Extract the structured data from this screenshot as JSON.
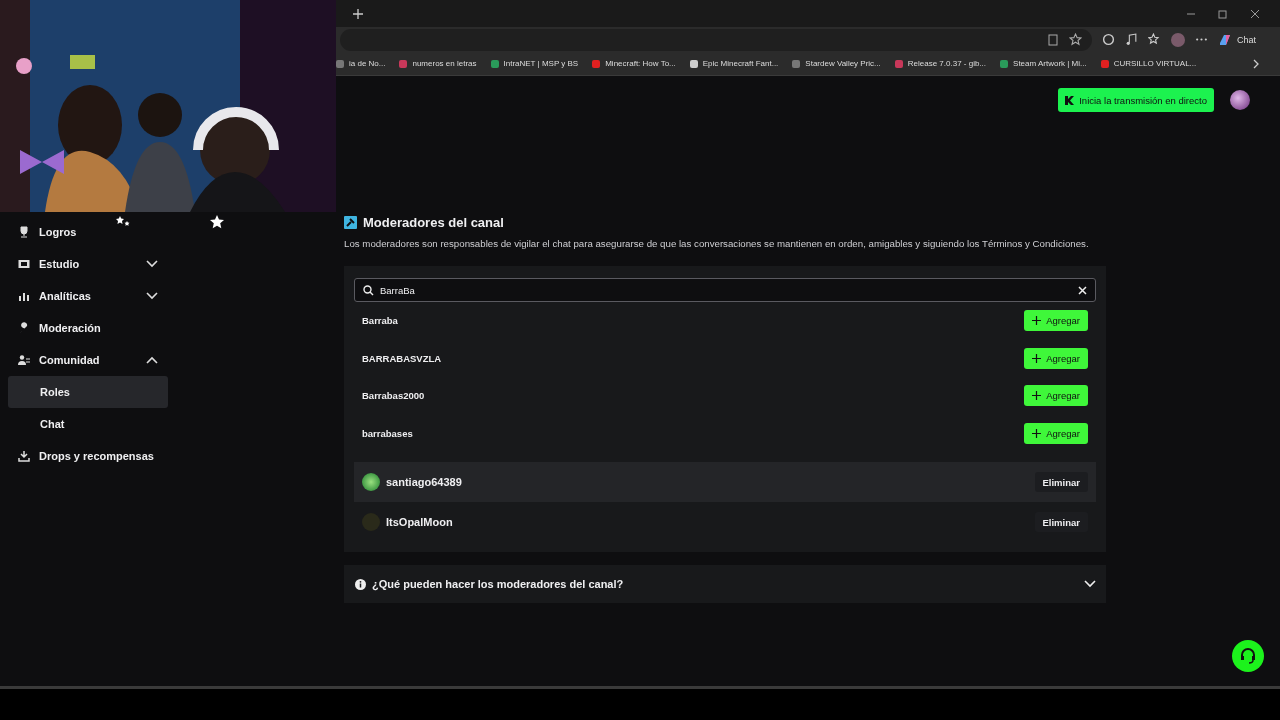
{
  "browser": {
    "chat_label": "Chat",
    "bookmarks": [
      "ia de No...",
      "numeros en letras",
      "IntraNET | MSP y BS",
      "Minecraft: How To...",
      "Epic Minecraft Fant...",
      "Stardew Valley Pric...",
      "Release 7.0.37 - gib...",
      "Steam Artwork | Mi...",
      "CURSILLO VIRTUAL..."
    ]
  },
  "header": {
    "go_live_button": "Inicia la transmisión en directo"
  },
  "sidebar": {
    "items": [
      {
        "label": "Logros"
      },
      {
        "label": "Estudio",
        "expanded": false
      },
      {
        "label": "Analíticas",
        "expanded": false
      },
      {
        "label": "Moderación"
      },
      {
        "label": "Comunidad",
        "expanded": true,
        "children": [
          {
            "label": "Roles",
            "selected": true
          },
          {
            "label": "Chat",
            "selected": false
          }
        ]
      },
      {
        "label": "Drops y recompensas"
      }
    ]
  },
  "moderators": {
    "title": "Moderadores del canal",
    "description": "Los moderadores son responsables de vigilar el chat para asegurarse de que las conversaciones se mantienen en orden, amigables y siguiendo los Términos y Condiciones.",
    "search": {
      "value": "BarraBa"
    },
    "results": [
      {
        "name": "Barraba",
        "button": "Agregar"
      },
      {
        "name": "BARRABASVZLA",
        "button": "Agregar"
      },
      {
        "name": "Barrabas2000",
        "button": "Agregar"
      },
      {
        "name": "barrabases",
        "button": "Agregar"
      }
    ],
    "current": [
      {
        "name": "santiago64389",
        "button": "Eliminar",
        "selected": true
      },
      {
        "name": "ItsOpalMoon",
        "button": "Eliminar",
        "selected": false
      }
    ],
    "faq": {
      "title": "¿Qué pueden hacer los moderadores del canal?",
      "expanded": false
    }
  }
}
